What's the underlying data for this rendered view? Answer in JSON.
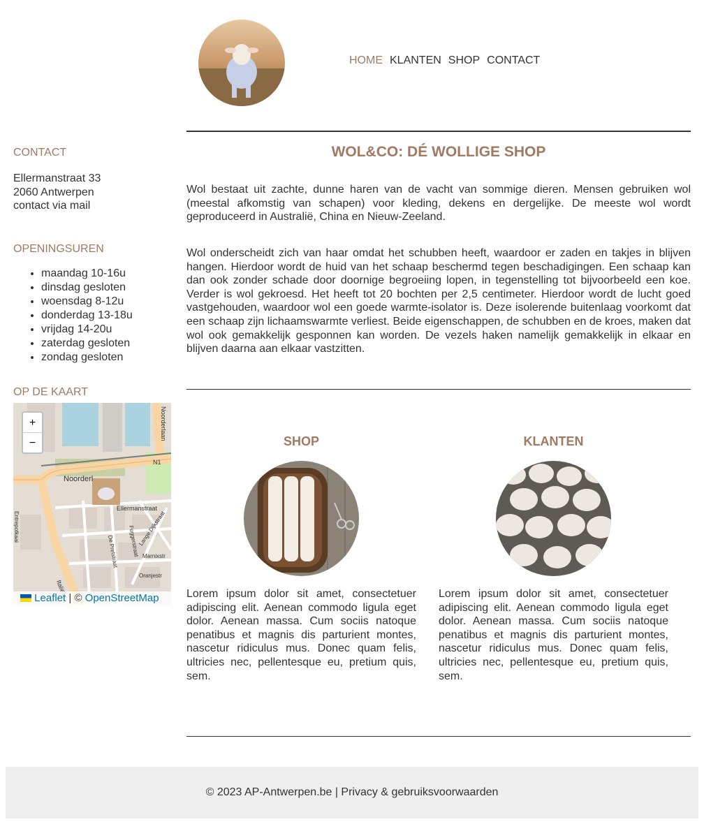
{
  "header": {
    "logo_alt": "lamb-logo",
    "nav": [
      {
        "label": "HOME",
        "active": true
      },
      {
        "label": "KLANTEN",
        "active": false
      },
      {
        "label": "SHOP",
        "active": false
      },
      {
        "label": "CONTACT",
        "active": false
      }
    ]
  },
  "sidebar": {
    "contact_heading": "CONTACT",
    "address_line1": "Ellermanstraat 33",
    "address_line2": "2060 Antwerpen",
    "contact_link": "contact via mail",
    "hours_heading": "OPENINGSUREN",
    "hours": [
      "maandag 10-16u",
      "dinsdag gesloten",
      "woensdag 8-12u",
      "donderdag 13-18u",
      "vrijdag 14-20u",
      "zaterdag gesloten",
      "zondag gesloten"
    ],
    "map_heading": "OP DE KAART",
    "map": {
      "zoom_in": "+",
      "zoom_out": "−",
      "attrib_leaflet": "Leaflet",
      "attrib_sep": " | © ",
      "attrib_osm": "OpenStreetMap",
      "street_labels": [
        "Noorderl",
        "Ellermanstraat",
        "N1",
        "Italiëlei",
        "De Pretstraat",
        "Marnixstr",
        "Oranjestr",
        "Fuggerstraat",
        "Lange Dijkstraat",
        "Entrepotkaai",
        "Noorderlaan"
      ]
    }
  },
  "main": {
    "title": "WOL&CO: DÉ WOLLIGE SHOP",
    "para1": "Wol bestaat uit zachte, dunne haren van de vacht van sommige dieren. Mensen gebruiken wol (meestal afkomstig van schapen) voor kleding, dekens en dergelijke. De meeste wol wordt geproduceerd in Australië, China en Nieuw-Zeeland.",
    "para2": "Wol onderscheidt zich van haar omdat het schubben heeft, waardoor er zaden en takjes in blijven hangen. Hierdoor wordt de huid van het schaap beschermd tegen beschadigingen. Een schaap kan dan ook zonder schade door doornige begroeiing lopen, in tegenstelling tot bijvoorbeeld een koe. Verder is wol gekroesd. Het heeft tot 20 bochten per 2,5 centimeter. Hierdoor wordt de lucht goed vastgehouden, waardoor wol een goede warmte-isolator is. Deze isolerende buitenlaag voorkomt dat een schaap zijn lichaamswarmte verliest. Beide eigenschappen, de schubben en de kroes, maken dat wol ook gemakkelijk gesponnen kan worden. De vezels haken namelijk gemakkelijk in elkaar en blijven daarna aan elkaar vastzitten.",
    "shop_heading": "SHOP",
    "shop_text": "Lorem ipsum dolor sit amet, consectetuer adipiscing elit. Aenean commodo ligula eget dolor. Aenean massa. Cum sociis natoque penatibus et magnis dis parturient montes, nascetur ridiculus mus. Donec quam felis, ultricies nec, pellentesque eu, pretium quis, sem.",
    "klanten_heading": "KLANTEN",
    "klanten_text": "Lorem ipsum dolor sit amet, consectetuer adipiscing elit. Aenean commodo ligula eget dolor. Aenean massa. Cum sociis natoque penatibus et magnis dis parturient montes, nascetur ridiculus mus. Donec quam felis, ultricies nec, pellentesque eu, pretium quis, sem."
  },
  "footer": {
    "text": "© 2023 AP-Antwerpen.be | Privacy & gebruiksvoorwaarden"
  },
  "colors": {
    "accent": "#a07a63",
    "text": "#333333",
    "footer_bg": "#efefef",
    "link": "#0078a8"
  }
}
